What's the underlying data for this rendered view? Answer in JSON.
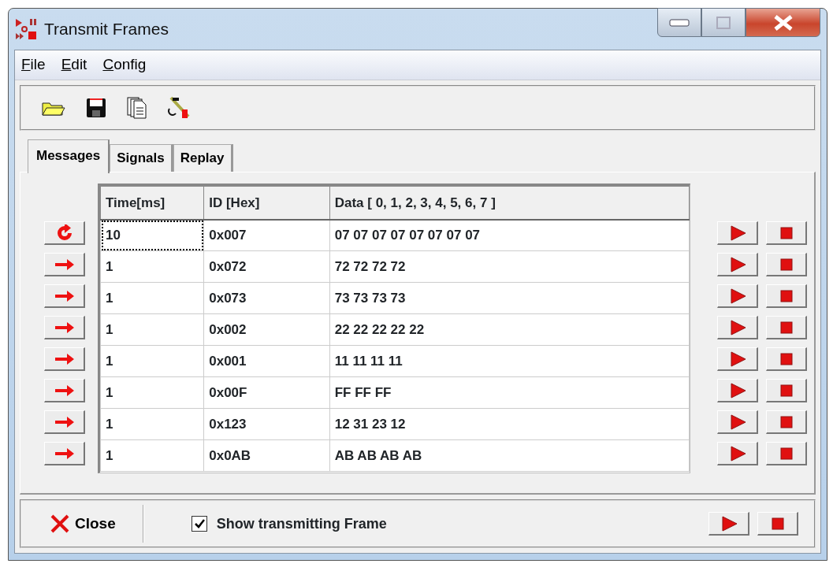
{
  "window": {
    "title": "Transmit Frames"
  },
  "menu": [
    {
      "label": "File"
    },
    {
      "label": "Edit"
    },
    {
      "label": "Config"
    }
  ],
  "tabs": [
    {
      "label": "Messages",
      "selected": true
    },
    {
      "label": "Signals",
      "selected": false
    },
    {
      "label": "Replay",
      "selected": false
    }
  ],
  "table": {
    "columns": [
      "Time[ms]",
      "ID [Hex]",
      "Data [ 0,  1,  2,  3,  4,  5,  6,  7 ]"
    ],
    "rows": [
      {
        "kind": "cyclic",
        "focused": true,
        "cells": [
          "10",
          "0x007",
          "07 07 07 07 07 07 07 07"
        ]
      },
      {
        "kind": "single",
        "focused": false,
        "cells": [
          "1",
          "0x072",
          "72 72 72 72"
        ]
      },
      {
        "kind": "single",
        "focused": false,
        "cells": [
          "1",
          "0x073",
          "73 73 73 73"
        ]
      },
      {
        "kind": "single",
        "focused": false,
        "cells": [
          "1",
          "0x002",
          "22 22 22 22 22"
        ]
      },
      {
        "kind": "single",
        "focused": false,
        "cells": [
          "1",
          "0x001",
          "11 11 11 11"
        ]
      },
      {
        "kind": "single",
        "focused": false,
        "cells": [
          "1",
          "0x00F",
          "FF FF FF"
        ]
      },
      {
        "kind": "single",
        "focused": false,
        "cells": [
          "1",
          "0x123",
          "12 31 23 12"
        ]
      },
      {
        "kind": "single",
        "focused": false,
        "cells": [
          "1",
          "0x0AB",
          "AB AB AB AB"
        ]
      }
    ]
  },
  "footer": {
    "close_label": "Close",
    "show_frame": {
      "label": "Show transmitting Frame",
      "checked": true
    }
  }
}
